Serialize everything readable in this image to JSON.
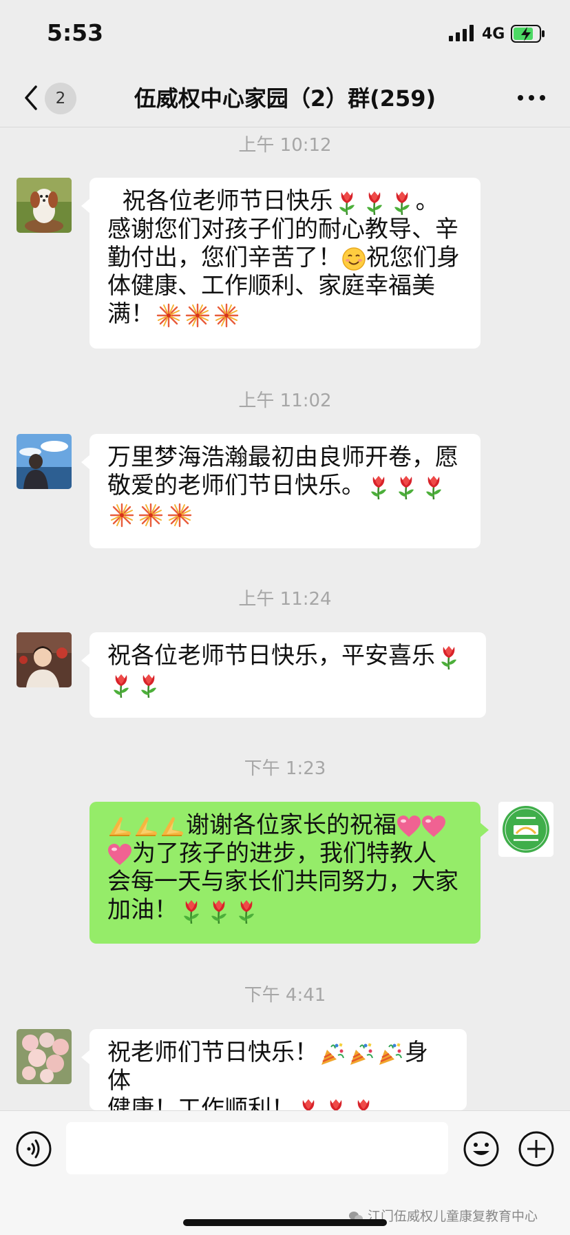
{
  "status_bar": {
    "time": "5:53",
    "network": "4G"
  },
  "nav": {
    "unread_count": "2",
    "title": "伍威权中心家园（2）群(259)"
  },
  "messages": [
    {
      "timestamp": "上午 10:12",
      "sender": "other",
      "lines": [
        "祝各位老师节日快乐",
        "。",
        "感谢您们对孩子们的耐心教导、辛",
        "勤付出，您们辛苦了！",
        "祝您们身",
        "体健康、工作顺利、家庭幸福美",
        "满！"
      ]
    },
    {
      "timestamp": "上午 11:02",
      "sender": "other",
      "lines": [
        "万里梦海浩瀚最初由良师开卷，愿",
        "敬爱的老师们节日快乐。"
      ]
    },
    {
      "timestamp": "上午 11:24",
      "sender": "other",
      "lines": [
        "祝各位老师节日快乐，平安喜乐"
      ]
    },
    {
      "timestamp": "下午 1:23",
      "sender": "me",
      "lines": [
        "谢谢各位家长的祝福",
        "为了孩子的进步，我们特教人",
        "会每一天与家长们共同努力，大家",
        "加油！"
      ]
    },
    {
      "timestamp": "下午 4:41",
      "sender": "other",
      "lines": [
        "祝老师们节日快乐！",
        "身体",
        "健康！工作顺利！"
      ]
    }
  ],
  "watermark": "江门伍威权儿童康复教育中心",
  "icons": {
    "back": "chevron-left-icon",
    "more": "more-dots-icon",
    "voice": "voice-icon",
    "emoji": "emoji-icon",
    "plus": "plus-icon",
    "tulip": "tulip-emoji",
    "firework": "fireworks-emoji",
    "heart": "heart-emoji",
    "clap": "folded-hands-emoji",
    "smile": "smiling-face-emoji",
    "popper": "party-popper-emoji"
  },
  "colors": {
    "background": "#ededed",
    "my_bubble": "#95ec69",
    "other_bubble": "#ffffff",
    "timestamp": "#a6a6a6"
  }
}
